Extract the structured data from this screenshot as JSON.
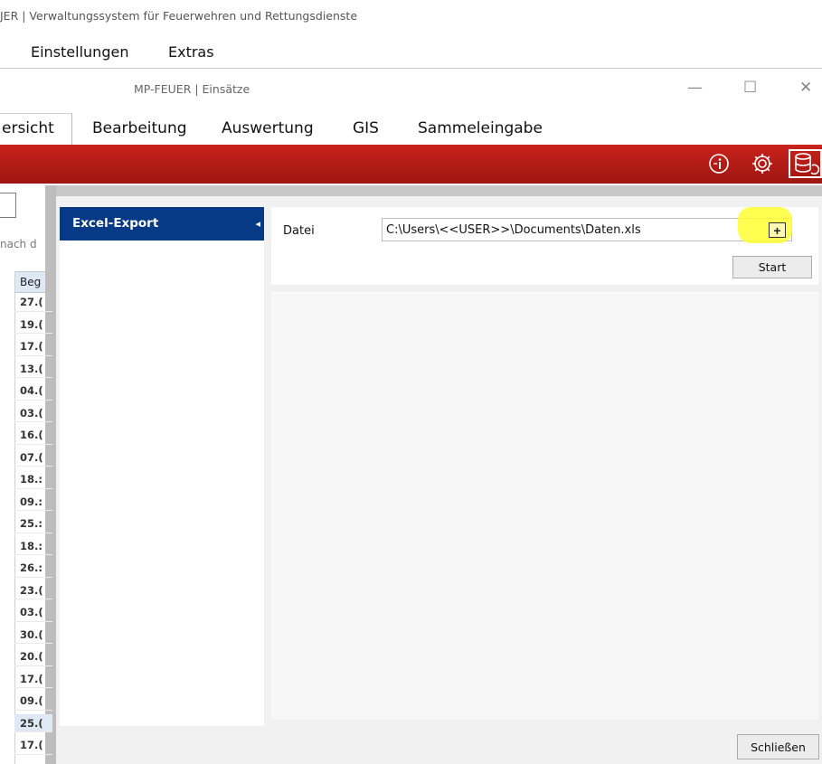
{
  "app": {
    "outer_title": "JER | Verwaltungssystem für Feuerwehren und Rettungsdienste",
    "outer_menu": [
      "Einstellungen",
      "Extras"
    ],
    "inner_title": "MP-FEUER | Einsätze"
  },
  "window_controls": {
    "minimize": "—",
    "maximize": "☐",
    "close": "✕"
  },
  "tabs": [
    {
      "label": "ersicht",
      "active": true
    },
    {
      "label": "Bearbeitung"
    },
    {
      "label": "Auswertung"
    },
    {
      "label": "GIS"
    },
    {
      "label": "Sammeleingabe"
    }
  ],
  "ribbon": {
    "icons": [
      "info-icon",
      "settings-gear-icon",
      "database-sync-icon"
    ],
    "background": "#b51c16"
  },
  "grid": {
    "search_hint": "nach d",
    "header": "Beg",
    "rows": [
      "27.(",
      "19.(",
      "17.(",
      "13.(",
      "04.(",
      "03.(",
      "16.(",
      "07.(",
      "18.:",
      "09.:",
      "25.:",
      "18.:",
      "26.:",
      "23.(",
      "03.(",
      "30.(",
      "20.(",
      "17.(",
      "09.(",
      "25.(",
      "17.("
    ]
  },
  "dialog": {
    "nav": {
      "items": [
        {
          "label": "Excel-Export",
          "arrow": "◂"
        }
      ]
    },
    "form": {
      "file_label": "Datei",
      "file_value": "C:\\Users\\<<USER>>\\Documents\\Daten.xls",
      "add_label": "+",
      "start_label": "Start"
    },
    "close_label": "Schließen",
    "nav_color": "#073a86",
    "highlight_color": "#ffff33"
  }
}
